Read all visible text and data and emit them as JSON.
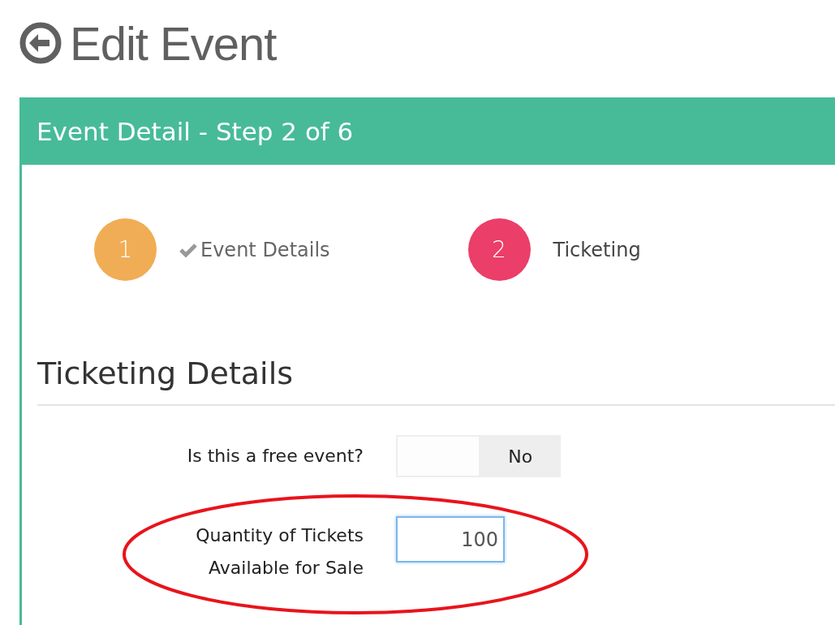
{
  "page_title": "Edit Event",
  "panel": {
    "title": "Event Detail - Step 2 of 6"
  },
  "steps": [
    {
      "number": "1",
      "label": "Event Details",
      "color": "#f0ad55",
      "completed": true
    },
    {
      "number": "2",
      "label": "Ticketing",
      "color": "#eb3e68",
      "completed": false
    }
  ],
  "section_title": "Ticketing Details",
  "fields": [
    {
      "kind": "toggle",
      "label": "Is this a free event?",
      "value": "No",
      "on": false,
      "highlighted": false
    },
    {
      "kind": "number",
      "label": "Quantity of Tickets Available for Sale",
      "value": "100",
      "highlighted": true
    }
  ]
}
